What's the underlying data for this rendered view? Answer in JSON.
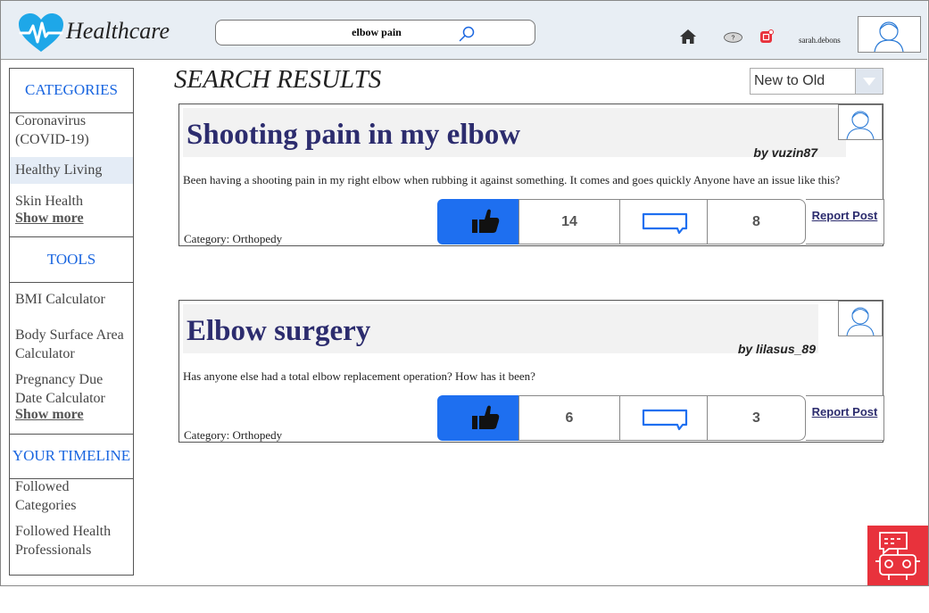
{
  "app": {
    "brand": "Healthcare",
    "search_value": "elbow pain",
    "username": "sarah.debons",
    "help_glyph": "?"
  },
  "sidebar": {
    "categories_heading": "CATEGORIES",
    "categories": [
      {
        "label": "Coronavirus (COVID-19)"
      },
      {
        "label": "Healthy Living"
      },
      {
        "label": "Skin Health"
      }
    ],
    "categories_show_more": "Show more",
    "tools_heading": "TOOLS",
    "tools": [
      {
        "label": "BMI Calculator"
      },
      {
        "label": "Body Surface Area Calculator"
      },
      {
        "label": "Pregnancy Due Date Calculator"
      }
    ],
    "tools_show_more": "Show more",
    "timeline_heading": "YOUR TIMELINE",
    "timeline": [
      {
        "label": "Followed Categories"
      },
      {
        "label": "Followed Health Professionals"
      }
    ]
  },
  "main": {
    "title": "SEARCH RESULTS",
    "sort_value": "New to Old"
  },
  "posts": [
    {
      "title": "Shooting pain in my elbow",
      "author": "by vuzin87",
      "body": "Been having a shooting pain in my right elbow when rubbing it against something. It comes and goes quickly Anyone have an issue like this?",
      "category": "Category: Orthopedy",
      "likes": "14",
      "comments": "8",
      "report_label": "Report Post"
    },
    {
      "title": "Elbow surgery",
      "author": "by lilasus_89",
      "body": "Has anyone else had a total elbow replacement operation? How has it been?",
      "category": "Category: Orthopedy",
      "likes": "6",
      "comments": "3",
      "report_label": "Report Post"
    }
  ],
  "icons": {
    "logo": "heart-pulse-icon",
    "search": "search-icon",
    "home": "home-icon",
    "help": "help-icon",
    "notifications": "notification-icon",
    "avatar": "user-avatar-icon",
    "like": "thumbs-up-icon",
    "comment": "comment-icon",
    "sort": "chevron-down-icon",
    "assistant": "chatbot-icon"
  },
  "colors": {
    "accent": "#1e6ff0",
    "heading_link": "#1a66e0",
    "title": "#2c2c6e",
    "header_bg": "#e8eef4",
    "notification": "#e8323c",
    "assistant_bg": "#e8323c"
  }
}
